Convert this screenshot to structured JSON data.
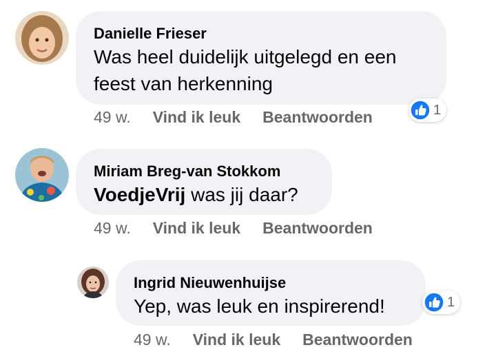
{
  "comments": [
    {
      "author": "Danielle Frieser",
      "text_line1": "Was heel duidelijk uitgelegd en een",
      "text_line2": "feest van herkenning",
      "age": "49 w.",
      "like_label": "Vind ik leuk",
      "reply_label": "Beantwoorden",
      "reaction_icon": "like-icon",
      "reaction_count": "1"
    },
    {
      "author": "Miriam Breg-van Stokkom",
      "mention": "VoedjeVrij",
      "text_rest": " was jij daar?",
      "age": "49 w.",
      "like_label": "Vind ik leuk",
      "reply_label": "Beantwoorden"
    },
    {
      "author": "Ingrid Nieuwenhuijse",
      "text_line1": "Yep, was leuk en inspirerend!",
      "age": "49 w.",
      "like_label": "Vind ik leuk",
      "reply_label": "Beantwoorden",
      "reaction_icon": "like-icon",
      "reaction_count": "1"
    }
  ],
  "colors": {
    "bubble": "#f0f2f5",
    "meta_text": "#65676b",
    "like_blue": "#1877f2"
  }
}
